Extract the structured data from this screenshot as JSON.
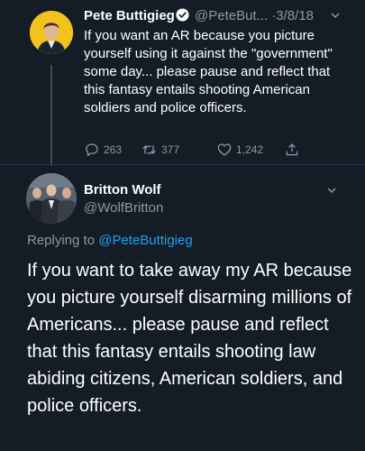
{
  "original_tweet": {
    "display_name": "Pete Buttigieg",
    "handle": "@PeteBut...",
    "separator": "·",
    "date": "3/8/18",
    "body": "If you want an AR because you picture yourself using it against the \"government\" some day... please pause and reflect that this fantasy entails shooting American soldiers and police officers.",
    "reply_count": "263",
    "retweet_count": "377",
    "like_count": "1,242",
    "verified": true
  },
  "reply_tweet": {
    "display_name": "Britton Wolf",
    "handle": "@WolfBritton",
    "replying_prefix": "Replying to",
    "replying_to": "@PeteButtigieg",
    "body": "If you want to take away my AR because you picture yourself disarming millions of Americans... please pause and reflect that this fantasy entails shooting law abiding citizens, American soldiers, and police officers."
  },
  "icons": {
    "verified": "verified-badge-icon",
    "reply": "reply-icon",
    "retweet": "retweet-icon",
    "like": "heart-icon",
    "share": "share-icon",
    "menu": "chevron-down-icon"
  },
  "colors": {
    "background": "#141d26",
    "text": "#ffffff",
    "muted": "#8899a6",
    "link": "#1da1f2",
    "verified": "#1da1f2"
  }
}
